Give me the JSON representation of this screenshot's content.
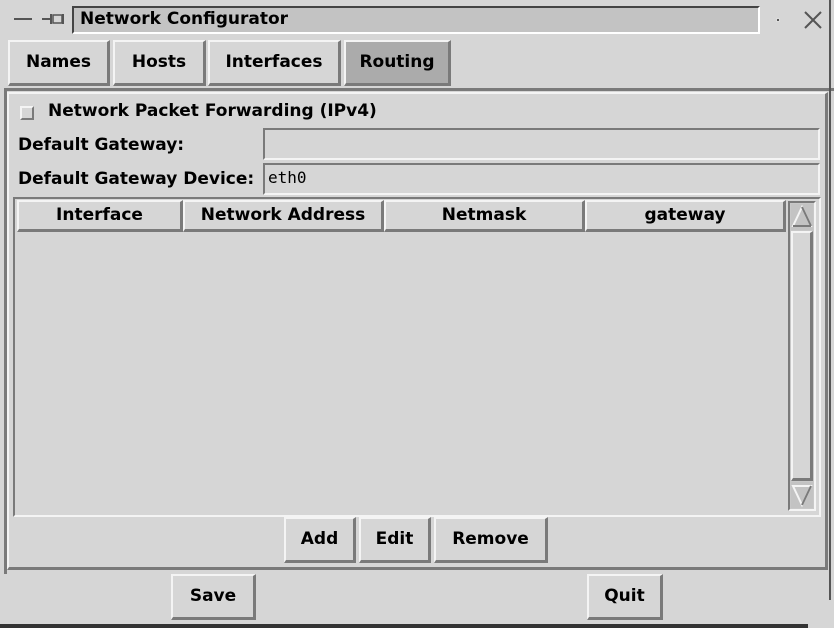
{
  "window": {
    "title": "Network Configurator"
  },
  "tabs": [
    {
      "label": "Names",
      "active": false
    },
    {
      "label": "Hosts",
      "active": false
    },
    {
      "label": "Interfaces",
      "active": false
    },
    {
      "label": "Routing",
      "active": true
    }
  ],
  "routing": {
    "forwarding_label": "Network Packet Forwarding (IPv4)",
    "forwarding_checked": false,
    "default_gateway_label": "Default Gateway:",
    "default_gateway_value": "",
    "default_gateway_device_label": "Default Gateway Device:",
    "default_gateway_device_value": "eth0"
  },
  "table": {
    "columns": [
      "Interface",
      "Network Address",
      "Netmask",
      "gateway"
    ],
    "rows": []
  },
  "actions": {
    "add": "Add",
    "edit": "Edit",
    "remove": "Remove"
  },
  "footer": {
    "save": "Save",
    "quit": "Quit"
  },
  "colors": {
    "background": "#d6d6d6",
    "active_tab": "#ababab",
    "title_field": "#c3c3c3"
  }
}
